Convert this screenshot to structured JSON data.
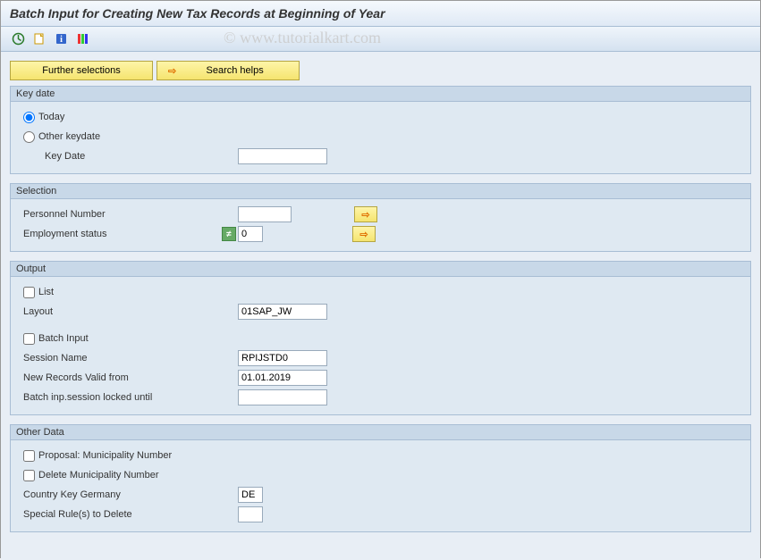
{
  "title": "Batch Input for Creating New Tax Records at Beginning of Year",
  "watermark": "© www.tutorialkart.com",
  "toolbar": {
    "execute_icon": "⏱",
    "variant_icon": "📄",
    "info_icon": "ℹ",
    "color_icon": "║"
  },
  "buttons": {
    "further_selections": "Further selections",
    "search_helps": "Search helps"
  },
  "groups": {
    "keydate": {
      "title": "Key date",
      "today_label": "Today",
      "other_label": "Other keydate",
      "keydate_label": "Key Date",
      "keydate_value": ""
    },
    "selection": {
      "title": "Selection",
      "personnel_label": "Personnel Number",
      "personnel_value": "",
      "employment_label": "Employment status",
      "employment_value": "0"
    },
    "output": {
      "title": "Output",
      "list_label": "List",
      "layout_label": "Layout",
      "layout_value": "01SAP_JW",
      "batch_input_label": "Batch Input",
      "session_name_label": "Session Name",
      "session_name_value": "RPIJSTD0",
      "new_records_label": "New Records Valid from",
      "new_records_value": "01.01.2019",
      "locked_until_label": "Batch inp.session locked until",
      "locked_until_value": ""
    },
    "other": {
      "title": "Other Data",
      "proposal_label": "Proposal: Municipality Number",
      "delete_muni_label": "Delete Municipality Number",
      "country_label": "Country Key Germany",
      "country_value": "DE",
      "special_rules_label": "Special Rule(s) to Delete",
      "special_rules_value": ""
    }
  }
}
